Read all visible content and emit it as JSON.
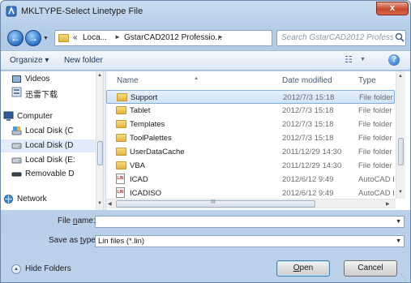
{
  "window": {
    "title": "MKLTYPE-Select Linetype File",
    "close_label": "x"
  },
  "address": {
    "crumbs": [
      "«",
      "Loca...",
      "GstarCAD2012 Professio..."
    ],
    "search_placeholder": "Search GstarCAD2012 Professi..."
  },
  "toolbar": {
    "organize_label": "Organize ▾",
    "new_folder_label": "New folder",
    "help_label": "?"
  },
  "nav": {
    "items": [
      {
        "label": "Videos",
        "icon": "video-icon"
      },
      {
        "label": "迅雷下载",
        "icon": "download-icon"
      },
      {
        "label": "Computer",
        "icon": "computer-icon"
      },
      {
        "label": "Local Disk (C",
        "icon": "drive-icon"
      },
      {
        "label": "Local Disk (D",
        "icon": "drive-icon",
        "selected": true
      },
      {
        "label": "Local Disk (E:",
        "icon": "drive-icon"
      },
      {
        "label": "Removable D",
        "icon": "removable-drive-icon"
      },
      {
        "label": "Network",
        "icon": "network-icon"
      }
    ]
  },
  "files": {
    "columns": [
      "Name",
      "Date modified",
      "Type"
    ],
    "rows": [
      {
        "name": "Support",
        "date": "2012/7/3 15:18",
        "type": "File folder",
        "kind": "folder",
        "selected": true
      },
      {
        "name": "Tablet",
        "date": "2012/7/3 15:18",
        "type": "File folder",
        "kind": "folder"
      },
      {
        "name": "Templates",
        "date": "2012/7/3 15:18",
        "type": "File folder",
        "kind": "folder"
      },
      {
        "name": "ToolPalettes",
        "date": "2012/7/3 15:18",
        "type": "File folder",
        "kind": "folder"
      },
      {
        "name": "UserDataCache",
        "date": "2011/12/29 14:30",
        "type": "File folder",
        "kind": "folder"
      },
      {
        "name": "VBA",
        "date": "2011/12/29 14:30",
        "type": "File folder",
        "kind": "folder"
      },
      {
        "name": "ICAD",
        "date": "2012/6/12 9:49",
        "type": "AutoCAD L",
        "kind": "lin"
      },
      {
        "name": "ICADISO",
        "date": "2012/6/12 9:49",
        "type": "AutoCAD L",
        "kind": "lin"
      }
    ],
    "h_scroll_label": "III"
  },
  "form": {
    "file_name_label_pre": "File ",
    "file_name_label_u": "n",
    "file_name_label_post": "ame:",
    "file_name_value": "",
    "save_type_label_pre": "Save as ",
    "save_type_label_u": "t",
    "save_type_label_post": "ype:",
    "save_type_value": "Lin files (*.lin)"
  },
  "footer": {
    "hide_folders_label": "Hide Folders",
    "open_label_u": "O",
    "open_label_post": "pen",
    "cancel_label": "Cancel"
  },
  "colors": {
    "selection": "#cfe4fa",
    "accent": "#2a6fc4",
    "close": "#c9462c"
  }
}
